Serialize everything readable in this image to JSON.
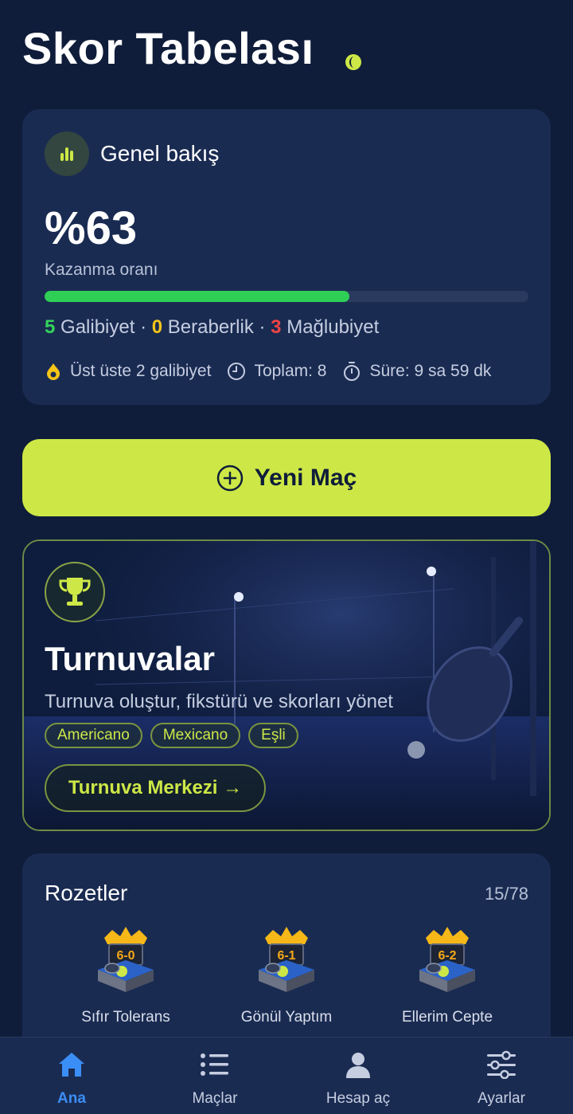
{
  "header": {
    "title": "Skor Tabelası"
  },
  "overview": {
    "title": "Genel bakış",
    "win_rate": "%63",
    "win_rate_label": "Kazanma oranı",
    "win_rate_fraction": 0.63,
    "wins": "5",
    "wins_label": "Galibiyet",
    "draws": "0",
    "draws_label": "Beraberlik",
    "losses": "3",
    "losses_label": "Mağlubiyet",
    "streak": "Üst üste 2 galibiyet",
    "total": "Toplam: 8",
    "duration": "Süre: 9 sa 59 dk"
  },
  "new_match": {
    "label": "Yeni Maç"
  },
  "tournaments": {
    "title": "Turnuvalar",
    "subtitle": "Turnuva oluştur, fikstürü ve skorları yönet",
    "tags": [
      "Americano",
      "Mexicano",
      "Eşli"
    ],
    "button": "Turnuva Merkezi →"
  },
  "badges": {
    "title": "Rozetler",
    "count": "15/78",
    "items": [
      {
        "label": "Sıfır Tolerans",
        "score": "6-0"
      },
      {
        "label": "Gönül Yaptım",
        "score": "6-1"
      },
      {
        "label": "Ellerim Cepte",
        "score": "6-2"
      }
    ]
  },
  "tabs": [
    {
      "label": "Ana",
      "icon": "home-icon",
      "active": true
    },
    {
      "label": "Maçlar",
      "icon": "list-icon",
      "active": false
    },
    {
      "label": "Hesap aç",
      "icon": "user-icon",
      "active": false
    },
    {
      "label": "Ayarlar",
      "icon": "sliders-icon",
      "active": false
    }
  ],
  "colors": {
    "background": "#0f1d3a",
    "card": "#1a2b52",
    "accent": "#cde846",
    "win": "#33d35b",
    "draw": "#f5c518",
    "loss": "#ef4444",
    "active_tab": "#3b8ef5"
  }
}
